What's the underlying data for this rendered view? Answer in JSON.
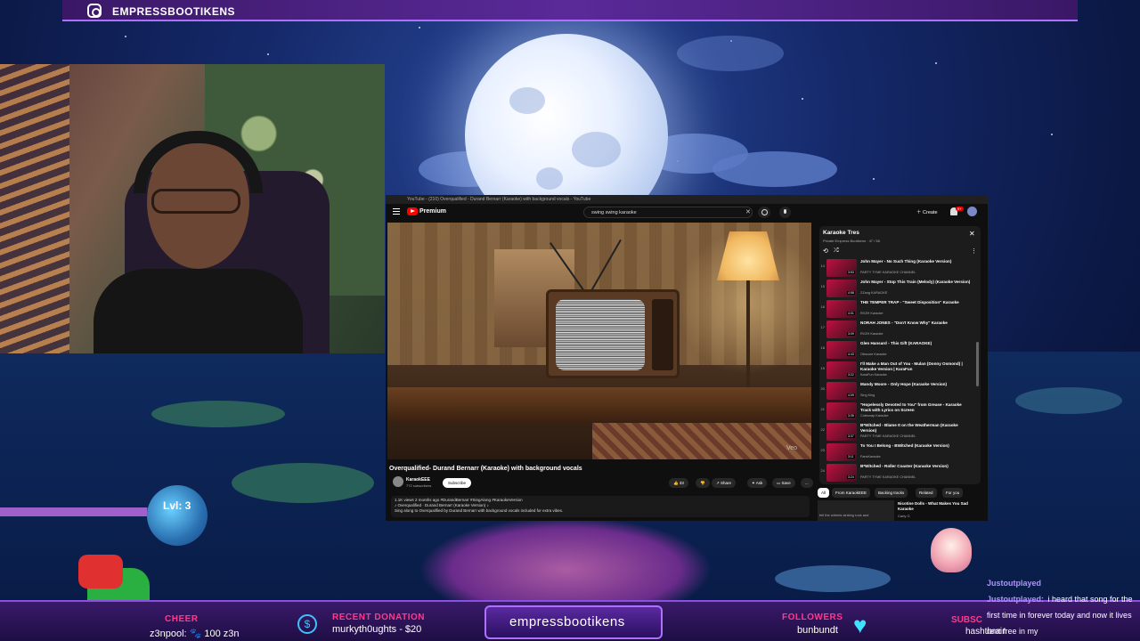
{
  "stream": {
    "instagram_handle": "EMPRESSBOOTIKENS",
    "center_name": "empressbootikens",
    "level_text": "Lvl: 3",
    "xp_progress": 0.97
  },
  "bottom_bar": {
    "cheer_label": "CHEER",
    "cheer_value": "z3npool: 🐾 100   z3n",
    "donation_label": "RECENT DONATION",
    "donation_value": "murkyth0ughts - $20",
    "followers_label": "FOLLOWERS",
    "followers_value": "bunbundt",
    "subs_label": "SUBSC",
    "subs_value": "hashtbrain"
  },
  "chat": {
    "messages": [
      {
        "user": "Justoutplayed",
        "text": ""
      },
      {
        "user": "Justoutplayed:",
        "text": "i heard that song for the first time in forever today and now it lives rent free in my"
      }
    ]
  },
  "youtube": {
    "chrome_title": "YouTube - (210) Overqualified - Durand Bernarr (Karaoke) with background vocals - YouTube",
    "brand": "Premium",
    "search_value": "swing swing karaoke",
    "create_label": "Create",
    "notif_count": "9+",
    "video": {
      "watermark": "Veo",
      "title": "Overqualified- Durand Bernarr (Karaoke) with background vocals",
      "channel": "KaraokEEE",
      "subscribers": "772 subscribers",
      "subscribe_label": "Subscribe",
      "likes": "33",
      "share_label": "Share",
      "ask_label": "Ask",
      "save_label": "Save",
      "more_label": "...",
      "desc_line1": "1.1K views  2 months ago  #DurandBernarr #SingAlong #KaraokeVersion",
      "desc_line2": "♪ Overqualified · Durand Bernarr (Karaoke Version) ♪",
      "desc_line3": "Sing along to Overqualified by Durand Bernarr with background vocals included for extra vibes."
    },
    "playlist": {
      "title": "Karaoke Tres",
      "meta": "Private  Empress Bootikens · 47 / 58",
      "items": [
        {
          "num": "14",
          "title": "John Mayer - No Such Thing (Karaoke Version)",
          "channel": "PARTY TYME KARAOKE CHANNEL",
          "duration": "3:53"
        },
        {
          "num": "15",
          "title": "John Mayer - Stop This Train (Melody) (Karaoke Version)",
          "channel": "ZZang KARAOKE",
          "duration": "4:58"
        },
        {
          "num": "16",
          "title": "THE TEMPER TRAP - \"Sweet Disposition\" Karaoke",
          "channel": "RVZH Karaoke",
          "duration": "4:01"
        },
        {
          "num": "17",
          "title": "NORAH JONES - \"Don't Know Why\" Karaoke",
          "channel": "RVZH Karaoke",
          "duration": "3:09"
        },
        {
          "num": "18",
          "title": "Glen Hansard - This Gift (KARAOKE)",
          "channel": "Obscure Karaoke",
          "duration": "4:43"
        },
        {
          "num": "19",
          "title": "I'll Make a Man Out of You - Mulan (Donny Osmond) | Karaoke Version | KaraFun",
          "channel": "KaraFun Karaoke",
          "duration": "3:22"
        },
        {
          "num": "20",
          "title": "Mandy Moore - Only Hope (Karaoke Version)",
          "channel": "Sing King",
          "duration": "4:09"
        },
        {
          "num": "21",
          "title": "\"Hopelessly Devoted to You\" from Grease - Karaoke Track with Lyrics on Screen",
          "channel": "Cutesnap Karaoke",
          "duration": "3:35"
        },
        {
          "num": "22",
          "title": "B*Witched - Blame It on the Weatherman (Karaoke Version)",
          "channel": "PARTY TYME KARAOKE CHANNEL",
          "duration": "3:37"
        },
        {
          "num": "23",
          "title": "To You I Belong - BWitched (Karaoke Version)",
          "channel": "FansKaraoke",
          "duration": "3:11"
        },
        {
          "num": "24",
          "title": "B*Witched - Roller Coaster (Karaoke Version)",
          "channel": "PARTY TYME KARAOKE CHANNEL",
          "duration": "3:24"
        }
      ]
    },
    "chips": [
      "All",
      "From KaraokEEE",
      "Backing tracks",
      "Related",
      "For you"
    ],
    "related": {
      "thumb_text": "fell the wheels sinking rock and",
      "title": "Nicotine Dolls - What Makes You Sad Karaoke",
      "channel": "Carly G"
    }
  }
}
